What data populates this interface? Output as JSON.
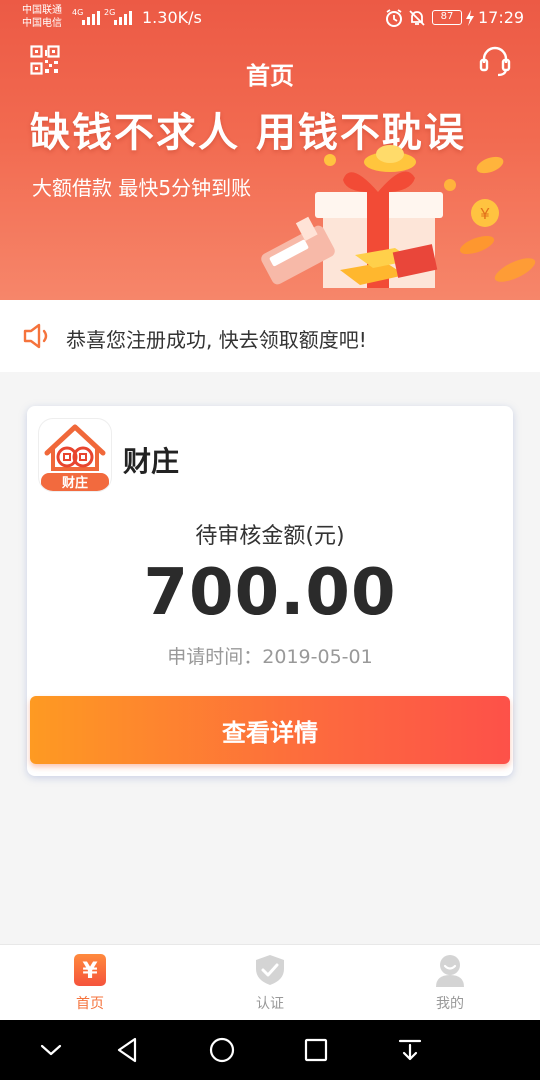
{
  "status_bar": {
    "carrier_1": "中国联通",
    "carrier_2": "中国电信",
    "net_1": "4G",
    "net_2": "2G",
    "speed": "1.30K/s",
    "battery": "87",
    "time": "17:29"
  },
  "header": {
    "title": "首页",
    "slogan": "缺钱不求人 用钱不耽误",
    "sub_slogan": "大额借款 最快5分钟到账"
  },
  "notice": {
    "text": "恭喜您注册成功, 快去领取额度吧!"
  },
  "card": {
    "app_name": "财庄",
    "logo_text": "财庄",
    "amount_label": "待审核金额(元)",
    "amount": "700.00",
    "apply_time": "申请时间：2019-05-01",
    "button_label": "查看详情"
  },
  "tabbar": {
    "home": "首页",
    "auth": "认证",
    "mine": "我的",
    "home_icon_glyph": "¥"
  },
  "colors": {
    "accent": "#f5733c",
    "banner_top": "#ec5a45",
    "button_start": "#fe9a22",
    "button_end": "#fd5149"
  }
}
